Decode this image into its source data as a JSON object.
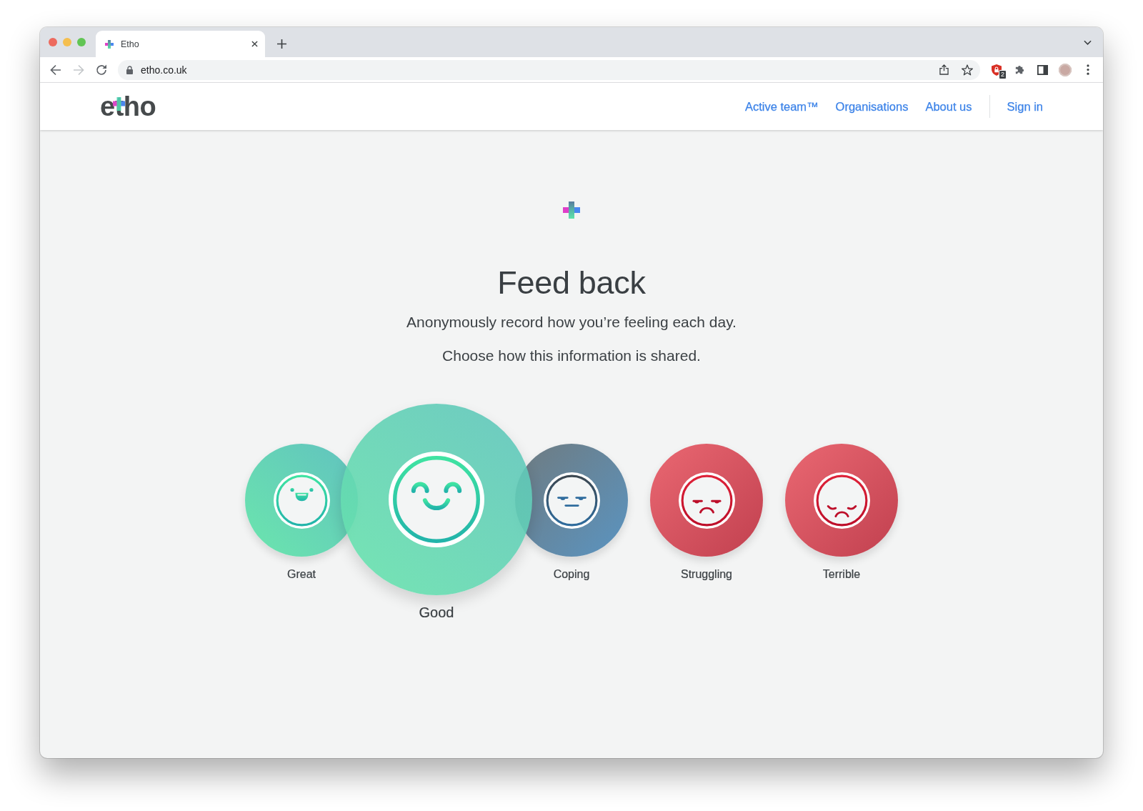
{
  "browser": {
    "tab_title": "Etho",
    "nav_buttons": [
      {
        "kind": "back",
        "disabled": false
      },
      {
        "kind": "forward",
        "disabled": true
      },
      {
        "kind": "reload",
        "disabled": false
      }
    ],
    "url": "etho.co.uk",
    "extension_badge": "2"
  },
  "header": {
    "logo": "etho",
    "nav": [
      {
        "label": "Active team™"
      },
      {
        "label": "Organisations"
      },
      {
        "label": "About us"
      }
    ],
    "sign_in": "Sign in"
  },
  "intro": {
    "title": "Feed back",
    "lines": [
      "Anonymously record how you’re feeling each day.",
      "Choose how this information is shared."
    ]
  },
  "moods": [
    {
      "kind": "great",
      "label": "Great",
      "selected": false
    },
    {
      "kind": "good",
      "label": "Good",
      "selected": true
    },
    {
      "kind": "coping",
      "label": "Coping",
      "selected": false
    },
    {
      "kind": "struggling",
      "label": "Struggling",
      "selected": false
    },
    {
      "kind": "terrible",
      "label": "Terrible",
      "selected": false
    }
  ]
}
